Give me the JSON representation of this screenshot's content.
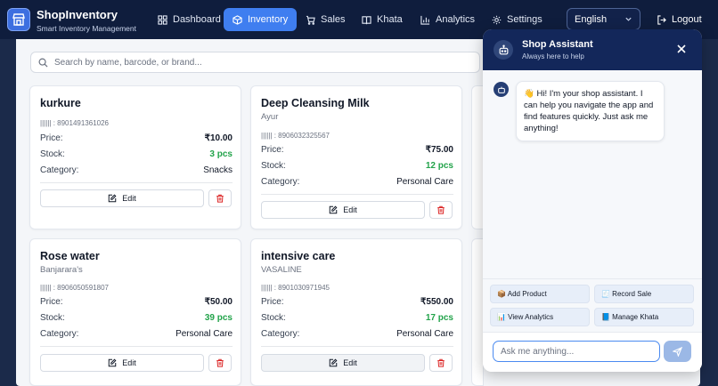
{
  "app": {
    "name": "ShopInventory",
    "tagline": "Smart Inventory Management"
  },
  "nav": [
    {
      "label": "Dashboard",
      "icon": "grid-icon"
    },
    {
      "label": "Inventory",
      "icon": "box-icon",
      "active": true
    },
    {
      "label": "Sales",
      "icon": "cart-icon"
    },
    {
      "label": "Khata",
      "icon": "book-icon"
    },
    {
      "label": "Analytics",
      "icon": "bar-chart-icon"
    },
    {
      "label": "Settings",
      "icon": "gear-icon"
    }
  ],
  "language": {
    "selected": "English"
  },
  "logout_label": "Logout",
  "search": {
    "placeholder": "Search by name, barcode, or brand..."
  },
  "labels": {
    "price": "Price:",
    "stock": "Stock:",
    "category": "Category:",
    "edit": "Edit"
  },
  "products": [
    {
      "name": "kurkure",
      "brand": "",
      "barcode": "8901491361026",
      "price": "₹10.00",
      "stock": "3 pcs",
      "category": "Snacks"
    },
    {
      "name": "Deep Cleansing Milk",
      "brand": "Ayur",
      "barcode": "8906032325567",
      "price": "₹75.00",
      "stock": "12 pcs",
      "category": "Personal Care"
    },
    {
      "name": "Rose water",
      "brand": "Banjarara's",
      "barcode": "8906050591807",
      "price": "₹50.00",
      "stock": "39 pcs",
      "category": "Personal Care"
    },
    {
      "name": "intensive care",
      "brand": "VASALINE",
      "barcode": "8901030971945",
      "price": "₹550.00",
      "stock": "17 pcs",
      "category": "Personal Care"
    }
  ],
  "assistant": {
    "title": "Shop Assistant",
    "subtitle": "Always here to help",
    "message": "👋 Hi! I'm your shop assistant. I can help you navigate the app and find features quickly. Just ask me anything!",
    "quick_actions": [
      "📦 Add Product",
      "🧾 Record Sale",
      "📊 View Analytics",
      "📘 Manage Khata"
    ],
    "input_placeholder": "Ask me anything..."
  },
  "colors": {
    "accent": "#3f7ef0",
    "topbar": "#0f1d3d",
    "stock_green": "#22a34a",
    "danger": "#dc2626"
  }
}
